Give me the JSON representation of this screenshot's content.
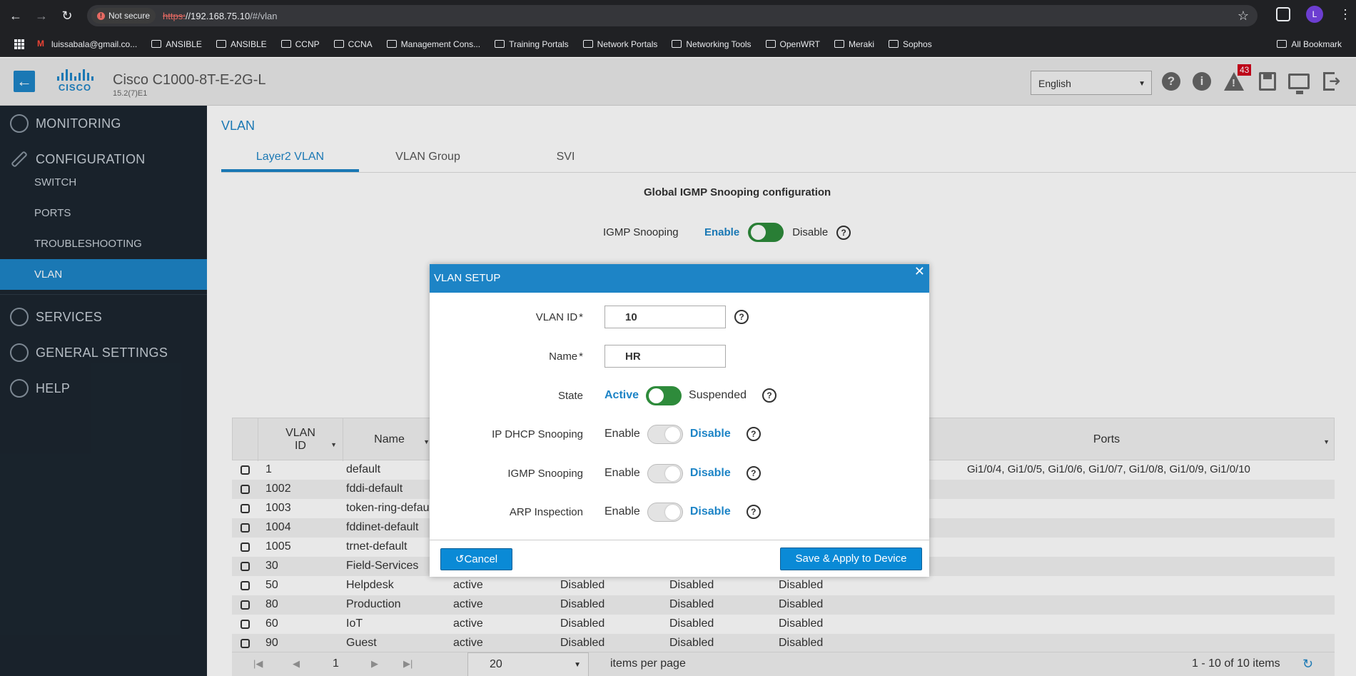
{
  "browser": {
    "security_label": "Not secure",
    "url_proto": "https:",
    "url_host": "//192.168.75.10",
    "url_path": "/#/vlan",
    "profile_initial": "L",
    "bookmarks": [
      "luissabala@gmail.co...",
      "ANSIBLE",
      "ANSIBLE",
      "CCNP",
      "CCNA",
      "Management Cons...",
      "Training Portals",
      "Network Portals",
      "Networking Tools",
      "OpenWRT",
      "Meraki",
      "Sophos"
    ],
    "all_bookmarks": "All Bookmark"
  },
  "header": {
    "logo_text": "CISCO",
    "model": "Cisco C1000-8T-E-2G-L",
    "version": "15.2(7)E1",
    "language": "English",
    "alert_count": "43"
  },
  "sidebar": {
    "monitoring": "MONITORING",
    "configuration": "CONFIGURATION",
    "config_items": [
      "SWITCH",
      "PORTS",
      "TROUBLESHOOTING",
      "VLAN"
    ],
    "services": "SERVICES",
    "general_settings": "GENERAL SETTINGS",
    "help": "HELP"
  },
  "page": {
    "title": "VLAN",
    "tabs": [
      "Layer2 VLAN",
      "VLAN Group",
      "SVI"
    ],
    "global_title": "Global IGMP Snooping configuration",
    "igmp_label": "IGMP Snooping",
    "igmp_enable": "Enable",
    "igmp_disable": "Disable"
  },
  "table": {
    "headers": {
      "vlan_id": "VLAN\nID",
      "name": "Name",
      "ports": "Ports"
    },
    "first_row_ports": "Gi1/0/4, Gi1/0/5, Gi1/0/6, Gi1/0/7, Gi1/0/8, Gi1/0/9, Gi1/0/10",
    "rows": [
      {
        "id": "1",
        "name": "default",
        "state": "",
        "a": "",
        "b": "",
        "c": ""
      },
      {
        "id": "1002",
        "name": "fddi-default",
        "state": "",
        "a": "",
        "b": "",
        "c": ""
      },
      {
        "id": "1003",
        "name": "token-ring-defau",
        "state": "",
        "a": "",
        "b": "",
        "c": ""
      },
      {
        "id": "1004",
        "name": "fddinet-default",
        "state": "",
        "a": "",
        "b": "",
        "c": ""
      },
      {
        "id": "1005",
        "name": "trnet-default",
        "state": "",
        "a": "",
        "b": "",
        "c": ""
      },
      {
        "id": "30",
        "name": "Field-Services",
        "state": "",
        "a": "",
        "b": "",
        "c": ""
      },
      {
        "id": "50",
        "name": "Helpdesk",
        "state": "active",
        "a": "Disabled",
        "b": "Disabled",
        "c": "Disabled"
      },
      {
        "id": "80",
        "name": "Production",
        "state": "active",
        "a": "Disabled",
        "b": "Disabled",
        "c": "Disabled"
      },
      {
        "id": "60",
        "name": "IoT",
        "state": "active",
        "a": "Disabled",
        "b": "Disabled",
        "c": "Disabled"
      },
      {
        "id": "90",
        "name": "Guest",
        "state": "active",
        "a": "Disabled",
        "b": "Disabled",
        "c": "Disabled"
      }
    ],
    "pager": {
      "page": "1",
      "page_size": "20",
      "items_per_page": "items per page",
      "count": "1 - 10 of 10 items"
    }
  },
  "modal": {
    "title": "VLAN SETUP",
    "vlan_id_label": "VLAN ID",
    "vlan_id_value": "10",
    "name_label": "Name",
    "name_value": "HR",
    "required_mark": "*",
    "state_label": "State",
    "state_on": "Active",
    "state_off": "Suspended",
    "dhcp_label": "IP DHCP Snooping",
    "igmp_label": "IGMP Snooping",
    "arp_label": "ARP Inspection",
    "enable": "Enable",
    "disable": "Disable",
    "cancel": "Cancel",
    "save": "Save & Apply to Device"
  },
  "colors": {
    "accent": "#1d84c6",
    "sidebar_bg": "#1c2630",
    "toggle_on": "#2e8b3b",
    "alert": "#d0021b"
  }
}
